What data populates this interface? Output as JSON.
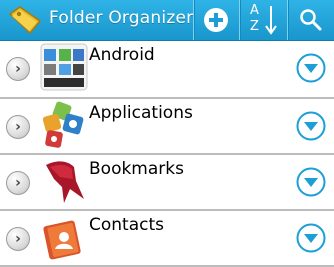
{
  "app": {
    "title": "Folder Organizer"
  },
  "toolbar": {
    "add_icon": "plus-circle-icon",
    "sort_label_top": "A",
    "sort_label_bottom": "Z",
    "sort_icon": "sort-az-icon",
    "search_icon": "search-icon"
  },
  "colors": {
    "toolbar": "#1fa6dc",
    "accent": "#1b9fd6",
    "divider": "#bcbcbc"
  },
  "rows": [
    {
      "label": "Android",
      "icon": "android-folder-icon"
    },
    {
      "label": "Applications",
      "icon": "applications-icon"
    },
    {
      "label": "Bookmarks",
      "icon": "bookmarks-ribbon-icon"
    },
    {
      "label": "Contacts",
      "icon": "contacts-book-icon"
    }
  ]
}
